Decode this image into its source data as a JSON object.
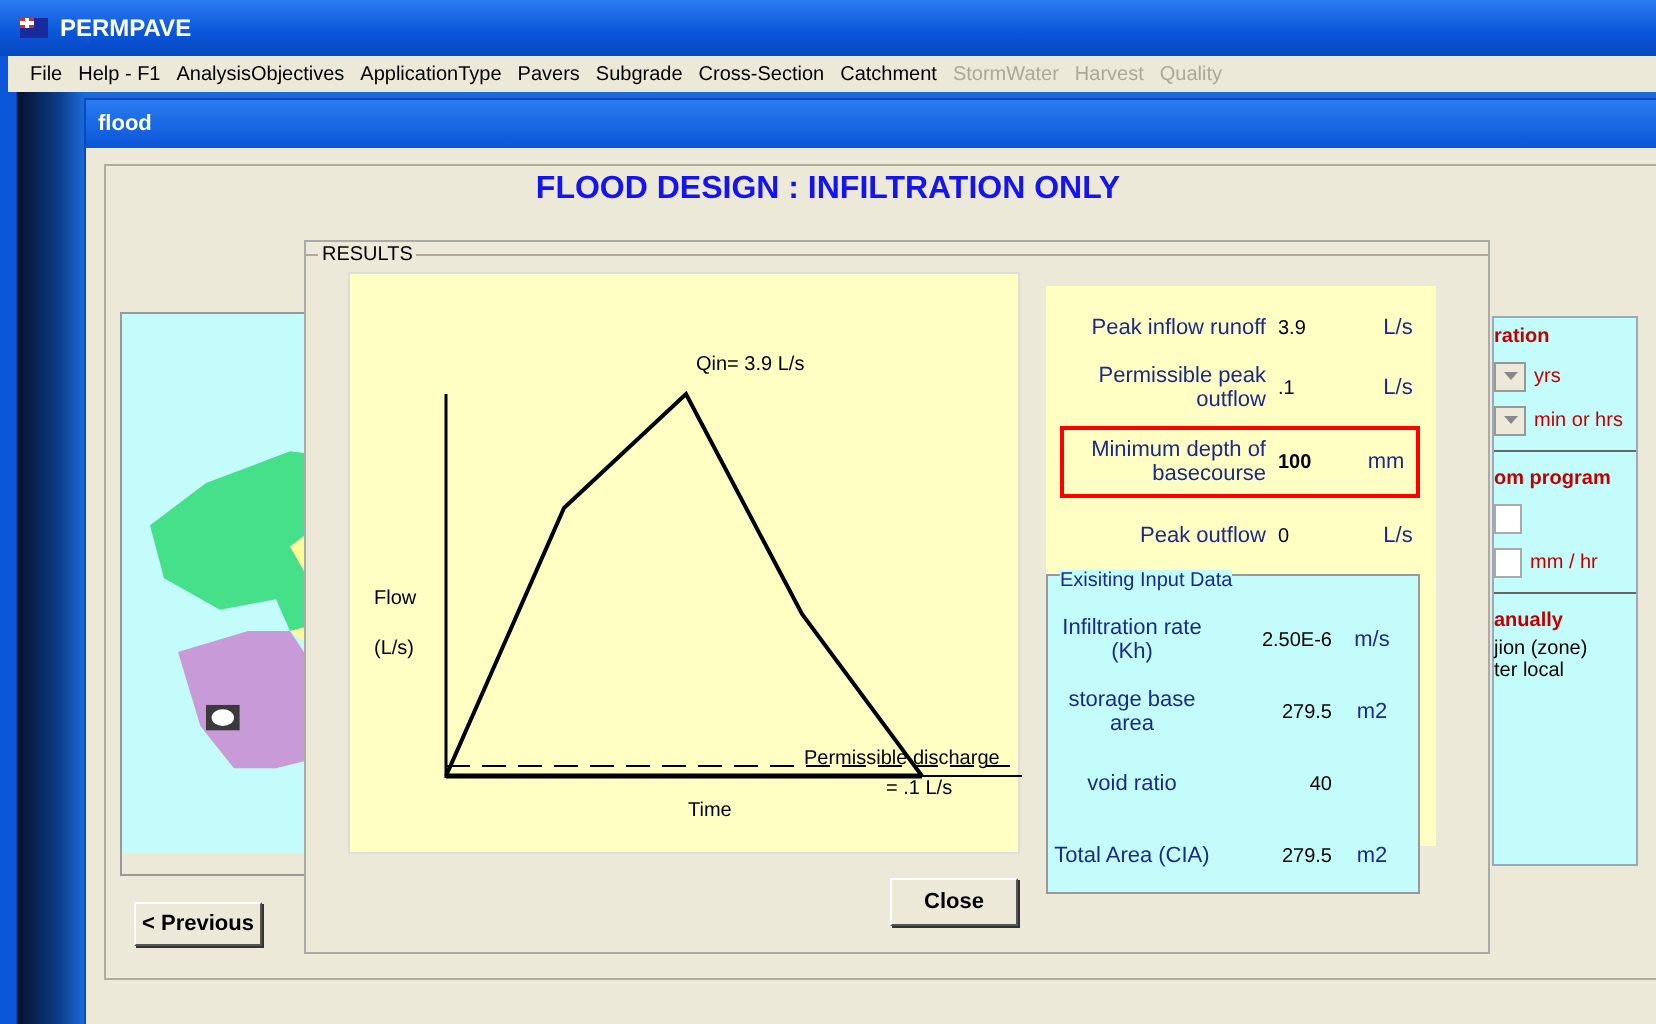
{
  "window": {
    "title": "PERMPAVE"
  },
  "menu": [
    {
      "label": "File",
      "disabled": false
    },
    {
      "label": "Help - F1",
      "disabled": false
    },
    {
      "label": "AnalysisObjectives",
      "disabled": false
    },
    {
      "label": "ApplicationType",
      "disabled": false
    },
    {
      "label": "Pavers",
      "disabled": false
    },
    {
      "label": "Subgrade",
      "disabled": false
    },
    {
      "label": "Cross-Section",
      "disabled": false
    },
    {
      "label": "Catchment",
      "disabled": false
    },
    {
      "label": "StormWater",
      "disabled": true
    },
    {
      "label": "Harvest",
      "disabled": true
    },
    {
      "label": "Quality",
      "disabled": true
    }
  ],
  "child_window": {
    "title": "flood",
    "heading": "FLOOD DESIGN :  INFILTRATION ONLY",
    "previous_button": "< Previous",
    "side_panel": [
      {
        "kind": "heading",
        "text": "ration"
      },
      {
        "kind": "dropdown",
        "text": "yrs"
      },
      {
        "kind": "dropdown",
        "text": "min or hrs"
      },
      {
        "kind": "rule"
      },
      {
        "kind": "heading",
        "text": "om program"
      },
      {
        "kind": "input"
      },
      {
        "kind": "input",
        "text": "mm / hr"
      },
      {
        "kind": "rule"
      },
      {
        "kind": "heading",
        "text": "anually"
      },
      {
        "kind": "note",
        "text": "jion (zone)"
      },
      {
        "kind": "note",
        "text": "ter local"
      }
    ]
  },
  "results": {
    "title": "RESULTS",
    "chart": {
      "peak_label": "Qin= 3.9 L/s",
      "ylabel_1": "Flow",
      "ylabel_2": "(L/s)",
      "xlabel": "Time",
      "limit_label_1": "Permissible discharge",
      "limit_label_2": "= .1 L/s"
    },
    "rows": [
      {
        "label": "Peak inflow runoff",
        "value": "3.9",
        "unit": "L/s",
        "highlighted": false
      },
      {
        "label": "Permissible peak outflow",
        "value": ".1",
        "unit": "L/s",
        "highlighted": false
      },
      {
        "label": "Minimum depth of basecourse",
        "value": "100",
        "unit": "mm",
        "highlighted": true
      },
      {
        "label": "Peak outflow",
        "value": "0",
        "unit": "L/s",
        "highlighted": false
      }
    ],
    "input_data": {
      "title": "Exisiting Input Data",
      "rows": [
        {
          "label": "Infiltration rate (Kh)",
          "value": "2.50E-6",
          "unit": "m/s"
        },
        {
          "label": "storage base area",
          "value": "279.5",
          "unit": "m2"
        },
        {
          "label": "void ratio",
          "value": "40"
        },
        {
          "label": "Total Area (CIA)",
          "value": "279.5",
          "unit": "m2"
        }
      ]
    },
    "close_button": "Close"
  }
}
